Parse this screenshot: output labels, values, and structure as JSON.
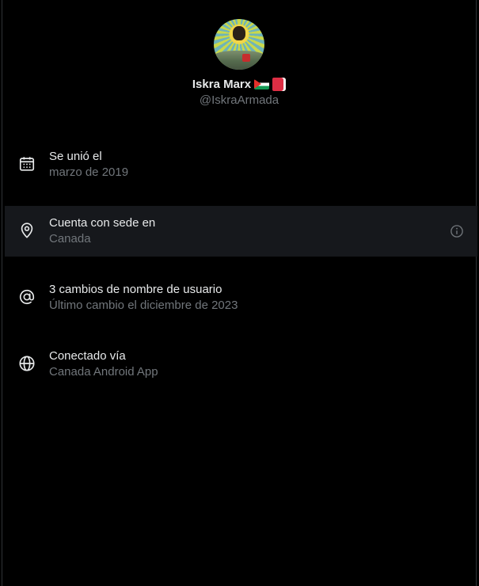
{
  "profile": {
    "name": "Iskra Marx",
    "handle": "@IskraArmada"
  },
  "rows": [
    {
      "icon": "calendar-icon",
      "title": "Se unió el",
      "subtitle": "marzo de 2019"
    },
    {
      "icon": "location-pin-icon",
      "title": "Cuenta con sede en",
      "subtitle": "Canada",
      "has_info": true
    },
    {
      "icon": "at-sign-icon",
      "title": "3 cambios de nombre de usuario",
      "subtitle": "Último cambio el diciembre de 2023"
    },
    {
      "icon": "globe-icon",
      "title": "Conectado vía",
      "subtitle": "Canada Android App"
    }
  ]
}
